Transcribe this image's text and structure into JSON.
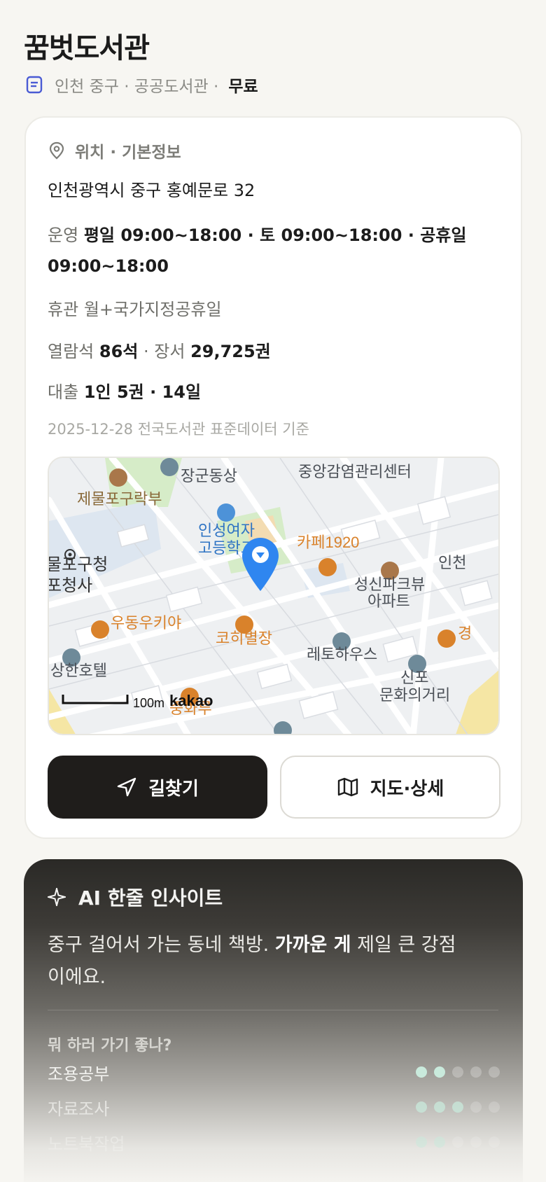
{
  "header": {
    "title": "꿈벗도서관",
    "meta": "인천 중구 · 공공도서관 ·",
    "fee": "무료"
  },
  "info": {
    "section_title": "위치 · 기본정보",
    "address": "인천광역시 중구 홍예문로 32",
    "hours_label": "운영",
    "hours_value": "평일 09:00~18:00 · 토 09:00~18:00 · 공휴일 09:00~18:00",
    "closed_label": "휴관",
    "closed_value": "월+국가지정공휴일",
    "seats_label": "열람석",
    "seats_value": "86석",
    "books_sep": " · 장서",
    "books_value": "29,725권",
    "loan_label": "대출",
    "loan_value": "1인 5권 · 14일",
    "source": "2025-12-28 전국도서관 표준데이터 기준"
  },
  "map": {
    "labels": {
      "jemulpo": "제물포구락부",
      "jangun": "장군동상",
      "centre": "중앙감염관리센터",
      "school1": "인성여자",
      "school2": "고등학교",
      "cafe": "카페1920",
      "apt1": "성신파크뷰",
      "apt2": "아파트",
      "incheon": "인천",
      "office1": "물포구청",
      "office2": "포청사",
      "udong": "우동우키야",
      "kohi": "코히별장",
      "retro": "레토하우스",
      "hotel": "상한호텔",
      "sinpo1": "신포",
      "sinpo2": "문화의거리",
      "gyeong": "경",
      "bottom_poi": "중화루",
      "scale": "100m",
      "brand": "kakao"
    }
  },
  "buttons": {
    "route": "길찾기",
    "map_detail": "지도·상세"
  },
  "ai": {
    "title": "AI 한줄 인사이트",
    "text_before": "중구 걸어서 가는 동네 책방.",
    "text_bold": "가까운 게",
    "text_after": "제일 큰 강점이에요.",
    "question": "뭐 하러 가기 좋나?",
    "activities": [
      {
        "label": "조용공부",
        "level": 2,
        "max": 5
      },
      {
        "label": "자료조사",
        "level": 3,
        "max": 5
      },
      {
        "label": "노트북작업",
        "level": 2,
        "max": 5
      }
    ]
  },
  "colors": {
    "accent_dark": "#1f1d1b",
    "pin_blue": "#2f86f0",
    "poi_orange": "#d9822b",
    "dot_on": "#c9eadc"
  }
}
